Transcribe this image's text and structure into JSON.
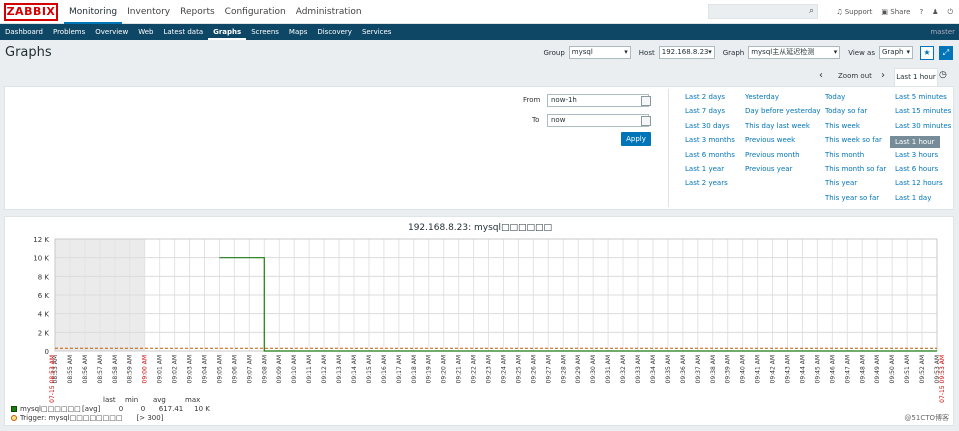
{
  "topbar": {
    "logo": "ZABBIX",
    "nav": [
      "Monitoring",
      "Inventory",
      "Reports",
      "Configuration",
      "Administration"
    ],
    "active_nav": "Monitoring",
    "support": "Support",
    "share": "Share",
    "help": "?",
    "user_icon": "user-icon",
    "power_icon": "power-icon"
  },
  "subnav": {
    "items": [
      "Dashboard",
      "Problems",
      "Overview",
      "Web",
      "Latest data",
      "Graphs",
      "Screens",
      "Maps",
      "Discovery",
      "Services"
    ],
    "active": "Graphs",
    "server": "master"
  },
  "header": {
    "title": "Graphs",
    "group_label": "Group",
    "group_value": "mysql",
    "host_label": "Host",
    "host_value": "192.168.8.23",
    "graph_label": "Graph",
    "graph_value": "mysql主从延迟检测",
    "view_label": "View as",
    "view_value": "Graph"
  },
  "timebar": {
    "zoom_out": "Zoom out",
    "range_tab": "Last 1 hour"
  },
  "filter": {
    "from_label": "From",
    "from_value": "now-1h",
    "to_label": "To",
    "to_value": "now",
    "apply": "Apply",
    "quick_ranges": [
      [
        "Last 2 days",
        "Last 7 days",
        "Last 30 days",
        "Last 3 months",
        "Last 6 months",
        "Last 1 year",
        "Last 2 years"
      ],
      [
        "Yesterday",
        "Day before yesterday",
        "This day last week",
        "Previous week",
        "Previous month",
        "Previous year"
      ],
      [
        "Today",
        "Today so far",
        "This week",
        "This week so far",
        "This month",
        "This month so far",
        "This year",
        "This year so far"
      ],
      [
        "Last 5 minutes",
        "Last 15 minutes",
        "Last 30 minutes",
        "Last 1 hour",
        "Last 3 hours",
        "Last 6 hours",
        "Last 12 hours",
        "Last 1 day"
      ]
    ],
    "selected_range": "Last 1 hour"
  },
  "graph": {
    "title": "192.168.8.23: mysql□□□□□□",
    "legend_head": [
      "last",
      "min",
      "avg",
      "max"
    ],
    "series_name": "mysql□□□□□□",
    "series_func": "[avg]",
    "series_stats": [
      "0",
      "0",
      "617.41",
      "10 K"
    ],
    "trigger_label": "Trigger: mysql□□□□□□□□",
    "trigger_cond": "[> 300]",
    "colors": {
      "series": "#1a7c11",
      "trigger": "#c25b00",
      "nodata": "#ebebeb"
    }
  },
  "chart_data": {
    "type": "line",
    "title": "192.168.8.23: mysql□□□□□□",
    "yticks": [
      "0",
      "2 K",
      "4 K",
      "6 K",
      "8 K",
      "10 K",
      "12 K"
    ],
    "ylim": [
      0,
      12000
    ],
    "xticks": [
      "08:53 AM",
      "08:55 AM",
      "08:56 AM",
      "08:57 AM",
      "08:58 AM",
      "08:59 AM",
      "09:00 AM",
      "09:01 AM",
      "09:02 AM",
      "09:03 AM",
      "09:04 AM",
      "09:05 AM",
      "09:06 AM",
      "09:07 AM",
      "09:08 AM",
      "09:09 AM",
      "09:10 AM",
      "09:11 AM",
      "09:12 AM",
      "09:13 AM",
      "09:14 AM",
      "09:15 AM",
      "09:16 AM",
      "09:17 AM",
      "09:18 AM",
      "09:19 AM",
      "09:20 AM",
      "09:21 AM",
      "09:22 AM",
      "09:23 AM",
      "09:24 AM",
      "09:25 AM",
      "09:26 AM",
      "09:27 AM",
      "09:28 AM",
      "09:29 AM",
      "09:30 AM",
      "09:31 AM",
      "09:32 AM",
      "09:33 AM",
      "09:34 AM",
      "09:35 AM",
      "09:36 AM",
      "09:37 AM",
      "09:38 AM",
      "09:39 AM",
      "09:40 AM",
      "09:41 AM",
      "09:42 AM",
      "09:43 AM",
      "09:44 AM",
      "09:45 AM",
      "09:46 AM",
      "09:47 AM",
      "09:48 AM",
      "09:49 AM",
      "09:50 AM",
      "09:51 AM",
      "09:52 AM",
      "09:53 AM"
    ],
    "xticks_red": [
      "09:00 AM"
    ],
    "x_start_label": "07-15 08:53 AM",
    "x_end_label": "07-15 09:53 AM",
    "series": [
      {
        "name": "mysql□□□□□□",
        "x": [
          "09:05 AM",
          "09:08 AM",
          "09:08 AM",
          "09:53 AM"
        ],
        "values": [
          10000,
          10000,
          0,
          0
        ]
      }
    ],
    "nodata_range": [
      "08:53 AM",
      "09:00 AM"
    ],
    "trigger_value": 300
  },
  "watermark": "@51CTO博客"
}
